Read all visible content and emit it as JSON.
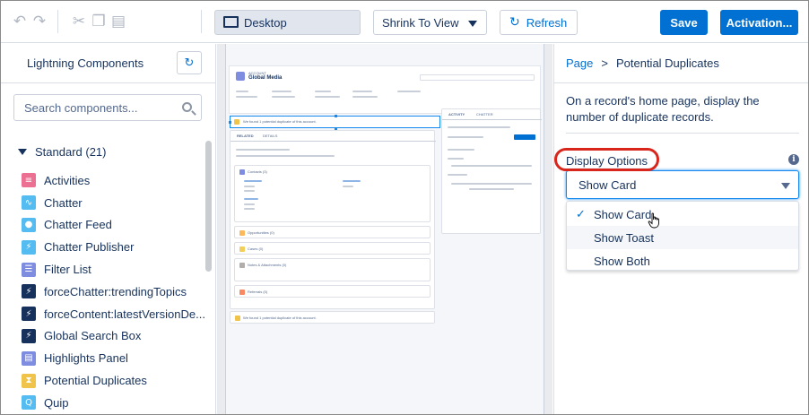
{
  "toolbar": {
    "undo_icon": "undo-icon",
    "redo_icon": "redo-icon",
    "cut_icon": "cut-icon",
    "copy_icon": "copy-icon",
    "paste_icon": "paste-icon",
    "device_label": "Desktop",
    "zoom_value": "Shrink To View",
    "refresh_label": "Refresh",
    "save_label": "Save",
    "activation_label": "Activation..."
  },
  "left_panel": {
    "title": "Lightning Components",
    "search_placeholder": "Search components...",
    "section_label": "Standard (21)",
    "items": [
      {
        "label": "Activities",
        "icon": "activities-icon",
        "color": "#eb7092"
      },
      {
        "label": "Chatter",
        "icon": "chatter-icon",
        "color": "#54bcf0"
      },
      {
        "label": "Chatter Feed",
        "icon": "chatter-feed-icon",
        "color": "#54bcf0"
      },
      {
        "label": "Chatter Publisher",
        "icon": "chatter-publisher-icon",
        "color": "#54bcf0"
      },
      {
        "label": "Filter List",
        "icon": "filter-list-icon",
        "color": "#7f8de1"
      },
      {
        "label": "forceChatter:trendingTopics",
        "icon": "lightning-icon",
        "color": "#16325c"
      },
      {
        "label": "forceContent:latestVersionDe...",
        "icon": "lightning-icon",
        "color": "#16325c"
      },
      {
        "label": "Global Search Box",
        "icon": "lightning-icon",
        "color": "#16325c"
      },
      {
        "label": "Highlights Panel",
        "icon": "highlights-panel-icon",
        "color": "#7f8de1"
      },
      {
        "label": "Potential Duplicates",
        "icon": "potential-duplicates-icon",
        "color": "#f0c34b"
      },
      {
        "label": "Quip",
        "icon": "quip-icon",
        "color": "#54bcf0"
      }
    ]
  },
  "canvas": {
    "record_type": "ACCOUNT",
    "record_name": "Global Media",
    "alert_text": "We found 1 potential duplicate of this account.",
    "tab_related": "RELATED",
    "tab_details": "DETAILS",
    "tab_activity": "ACTIVITY",
    "tab_chatter": "CHATTER",
    "contacts_label": "Contacts (3)",
    "opportunities_label": "Opportunities (0)",
    "cases_label": "Cases (0)",
    "notes_label": "Notes & Attachments (0)",
    "referrals_label": "Referrals (0)",
    "footer_alert": "We found 1 potential duplicate of this account."
  },
  "right_panel": {
    "breadcrumb_root": "Page",
    "breadcrumb_sep": ">",
    "breadcrumb_current": "Potential Duplicates",
    "description": "On a record's home page, display the number of duplicate records.",
    "display_options_label": "Display Options",
    "selected_option": "Show Card",
    "options": [
      "Show Card",
      "Show Toast",
      "Show Both"
    ],
    "info_icon": "info-icon"
  }
}
